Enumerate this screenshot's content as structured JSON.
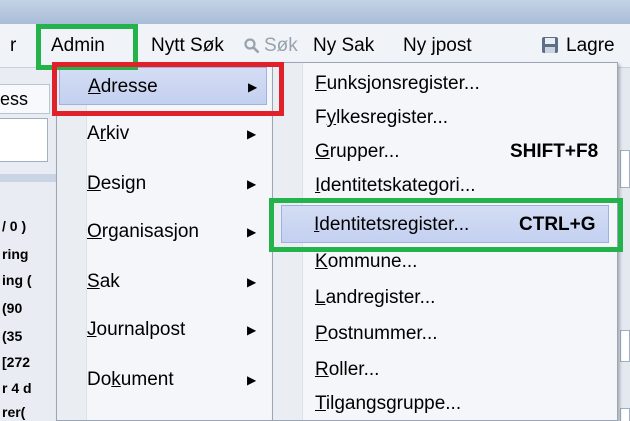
{
  "menubar": {
    "items": [
      {
        "label": "r"
      },
      {
        "label": "Admin"
      },
      {
        "label": "Nytt Søk"
      },
      {
        "label": "Søk"
      },
      {
        "label": "Ny Sak"
      },
      {
        "label": "Ny jpost"
      },
      {
        "label": "Lagre"
      }
    ]
  },
  "background": {
    "tab_label": "ess",
    "lines": [
      "/ 0 )",
      "ring",
      "ing (",
      " (90",
      " (35",
      "[272",
      "r 4 d",
      "rer("
    ]
  },
  "admin_menu": {
    "items": [
      {
        "label": "Adresse",
        "mnemonic": "A",
        "rest": "dresse",
        "submenu": true
      },
      {
        "label": "Arkiv",
        "pre": "A",
        "mnemonic": "r",
        "rest": "kiv",
        "submenu": true
      },
      {
        "label": "Design",
        "mnemonic": "D",
        "rest": "esign",
        "submenu": true
      },
      {
        "label": "Organisasjon",
        "mnemonic": "O",
        "rest": "rganisasjon",
        "submenu": true
      },
      {
        "label": "Sak",
        "mnemonic": "S",
        "rest": "ak",
        "submenu": true
      },
      {
        "label": "Journalpost",
        "mnemonic": "J",
        "rest": "ournalpost",
        "submenu": true
      },
      {
        "label": "Dokument",
        "pre": "Do",
        "mnemonic": "k",
        "rest": "ument",
        "submenu": true
      }
    ]
  },
  "adresse_submenu": {
    "items": [
      {
        "mnemonic": "F",
        "rest": "unksjonsregister...",
        "shortcut": ""
      },
      {
        "pre": "F",
        "mnemonic": "y",
        "rest": "lkesregister...",
        "shortcut": ""
      },
      {
        "mnemonic": "G",
        "rest": "rupper...",
        "shortcut": "SHIFT+F8"
      },
      {
        "mnemonic": "I",
        "rest": "dentitetskategori...",
        "shortcut": ""
      },
      {
        "mnemonic": "I",
        "rest": "dentitetsregister...",
        "shortcut": "CTRL+G"
      },
      {
        "mnemonic": "K",
        "rest": "ommune...",
        "shortcut": ""
      },
      {
        "mnemonic": "L",
        "rest": "andregister...",
        "shortcut": ""
      },
      {
        "mnemonic": "P",
        "rest": "ostnummer...",
        "shortcut": ""
      },
      {
        "mnemonic": "R",
        "rest": "oller...",
        "shortcut": ""
      },
      {
        "mnemonic": "T",
        "rest": "ilgangsgruppe...",
        "shortcut": ""
      }
    ]
  },
  "colors": {
    "annotation_green": "#24b24b",
    "annotation_red": "#e0212a",
    "highlight": "#c3d0f0"
  },
  "icons": {
    "search": "magnifier-icon",
    "save": "floppy-disk-icon",
    "submenu": "triangle-right-icon"
  }
}
